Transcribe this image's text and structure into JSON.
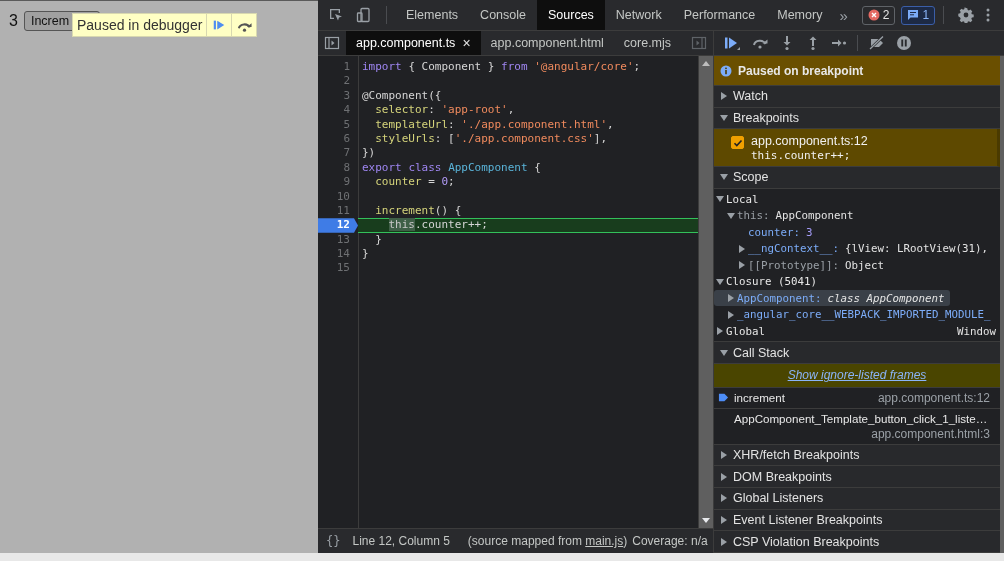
{
  "page": {
    "counter": "3",
    "button": "Increm",
    "overlay": {
      "message": "Paused in debugger"
    }
  },
  "toolbar": {
    "tabs": [
      {
        "label": "Elements",
        "selected": false
      },
      {
        "label": "Console",
        "selected": false
      },
      {
        "label": "Sources",
        "selected": true
      },
      {
        "label": "Network",
        "selected": false
      },
      {
        "label": "Performance",
        "selected": false
      },
      {
        "label": "Memory",
        "selected": false
      }
    ],
    "more": "»",
    "error_count": "2",
    "message_count": "1"
  },
  "file_tabs": [
    {
      "label": "app.component.ts",
      "selected": true,
      "close": "×"
    },
    {
      "label": "app.component.html",
      "selected": false
    },
    {
      "label": "core.mjs",
      "selected": false
    }
  ],
  "editor": {
    "lines": [
      {
        "number": "1",
        "current": false,
        "tokens": [
          {
            "kind": "kw",
            "text": "import"
          },
          {
            "kind": "plain",
            "text": " { Component } "
          },
          {
            "kind": "kw",
            "text": "from"
          },
          {
            "kind": "str",
            "text": " '@angular/core'"
          },
          {
            "kind": "plain",
            "text": ";"
          }
        ]
      },
      {
        "number": "2",
        "current": false
      },
      {
        "number": "3",
        "current": false,
        "tokens": [
          {
            "kind": "plain",
            "text": "@Component({"
          }
        ]
      },
      {
        "number": "4",
        "current": false,
        "tokens": [
          {
            "kind": "prop",
            "text": "  selector"
          },
          {
            "kind": "plain",
            "text": ": "
          },
          {
            "kind": "str",
            "text": "'app-root'"
          },
          {
            "kind": "plain",
            "text": ","
          }
        ]
      },
      {
        "number": "5",
        "current": false,
        "tokens": [
          {
            "kind": "prop",
            "text": "  templateUrl"
          },
          {
            "kind": "plain",
            "text": ": "
          },
          {
            "kind": "str",
            "text": "'./app.component.html'"
          },
          {
            "kind": "plain",
            "text": ","
          }
        ]
      },
      {
        "number": "6",
        "current": false,
        "tokens": [
          {
            "kind": "prop",
            "text": "  styleUrls"
          },
          {
            "kind": "plain",
            "text": ": ["
          },
          {
            "kind": "str",
            "text": "'./app.component.css'"
          },
          {
            "kind": "plain",
            "text": "],"
          }
        ]
      },
      {
        "number": "7",
        "current": false,
        "tokens": [
          {
            "kind": "plain",
            "text": "})"
          }
        ]
      },
      {
        "number": "8",
        "current": false,
        "tokens": [
          {
            "kind": "kw",
            "text": "export"
          },
          {
            "kind": "kw",
            "text": " class"
          },
          {
            "kind": "def",
            "text": " AppComponent"
          },
          {
            "kind": "plain",
            "text": " {"
          }
        ]
      },
      {
        "number": "9",
        "current": false,
        "tokens": [
          {
            "kind": "prop",
            "text": "  counter"
          },
          {
            "kind": "plain",
            "text": " = "
          },
          {
            "kind": "num",
            "text": "0"
          },
          {
            "kind": "plain",
            "text": ";"
          }
        ]
      },
      {
        "number": "10",
        "current": false
      },
      {
        "number": "11",
        "current": false,
        "tokens": [
          {
            "kind": "prop",
            "text": "  increment"
          },
          {
            "kind": "plain",
            "text": "() {"
          }
        ]
      },
      {
        "number": "12",
        "current": true,
        "tokens": [
          {
            "kind": "exec",
            "text": "    this"
          },
          {
            "kind": "plain",
            "text": ".counter++;"
          }
        ]
      },
      {
        "number": "13",
        "current": false,
        "tokens": [
          {
            "kind": "plain",
            "text": "  }"
          }
        ]
      },
      {
        "number": "14",
        "current": false,
        "tokens": [
          {
            "kind": "plain",
            "text": "}"
          }
        ]
      },
      {
        "number": "15",
        "current": false
      }
    ]
  },
  "status_bar": {
    "pretty_print": "{}",
    "position": "Line 12, Column 5",
    "source_map": {
      "before": "(source mapped from",
      "link": "main.js",
      "after": ")"
    },
    "coverage": "Coverage: n/a"
  },
  "debugger": {
    "banner": "Paused on breakpoint",
    "sections": [
      {
        "kind": "plain",
        "title": "Watch",
        "expanded": false
      },
      {
        "kind": "breakpoints",
        "title": "Breakpoints",
        "expanded": true,
        "items": [
          {
            "location": "app.component.ts:12",
            "code": "this.counter++;",
            "checked": true
          }
        ]
      },
      {
        "kind": "scope",
        "title": "Scope",
        "expanded": true,
        "tree": [
          {
            "name": "Local",
            "kind": "scope",
            "expanded": true,
            "selected": false,
            "children": [
              {
                "name": "this:",
                "kind": "internal",
                "value": {
                  "kind": "object",
                  "text": "AppComponent"
                },
                "expanded": true,
                "selected": false,
                "children": [
                  {
                    "name": "counter:",
                    "kind": "property",
                    "value": {
                      "kind": "number",
                      "text": "3"
                    },
                    "selected": false
                  },
                  {
                    "name": "__ngContext__:",
                    "kind": "property",
                    "value": {
                      "kind": "object",
                      "text": "{lView: LRootView(31),"
                    },
                    "expanded": false,
                    "selected": false
                  },
                  {
                    "name": "[[Prototype]]:",
                    "kind": "internal",
                    "value": {
                      "kind": "object",
                      "text": "Object"
                    },
                    "expanded": false,
                    "selected": false
                  }
                ]
              }
            ]
          },
          {
            "name": "Closure (5041)",
            "kind": "scope",
            "expanded": true,
            "selected": false,
            "children": [
              {
                "name": "AppComponent:",
                "kind": "property",
                "value": {
                  "kind": "class",
                  "text": "class AppComponent"
                },
                "expanded": false,
                "selected": true
              },
              {
                "name": "_angular_core__WEBPACK_IMPORTED_MODULE_",
                "kind": "property",
                "expanded": false,
                "selected": false
              }
            ]
          },
          {
            "name": "Global",
            "kind": "scope",
            "value": {
              "kind": "global",
              "text": "Window"
            },
            "expanded": false,
            "selected": false
          }
        ]
      },
      {
        "kind": "callstack",
        "title": "Call Stack",
        "expanded": true,
        "link": "Show ignore-listed frames",
        "frames": [
          {
            "name": "increment",
            "location": "app.component.ts:12",
            "selected": true
          },
          {
            "name": "AppComponent_Template_button_click_1_liste…",
            "location": "app.component.html:3",
            "selected": false
          }
        ]
      },
      {
        "kind": "plain",
        "title": "XHR/fetch Breakpoints",
        "expanded": false
      },
      {
        "kind": "plain",
        "title": "DOM Breakpoints",
        "expanded": false
      },
      {
        "kind": "plain",
        "title": "Global Listeners",
        "expanded": false
      },
      {
        "kind": "plain",
        "title": "Event Listener Breakpoints",
        "expanded": false
      },
      {
        "kind": "plain",
        "title": "CSP Violation Breakpoints",
        "expanded": false
      }
    ]
  }
}
